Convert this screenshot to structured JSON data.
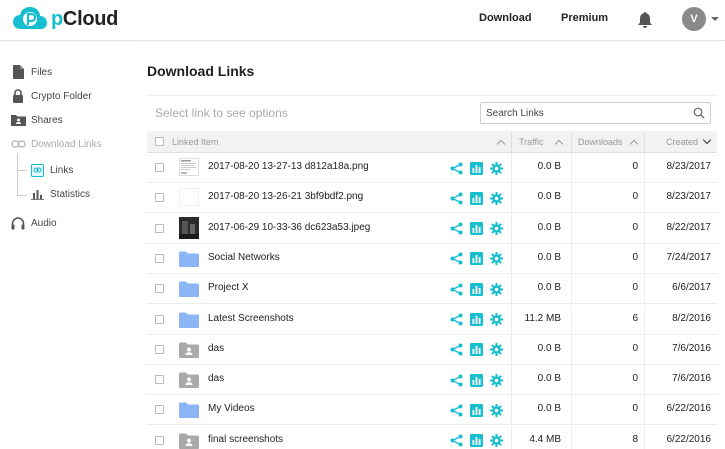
{
  "header": {
    "brand_prefix": "p",
    "brand_suffix": "Cloud",
    "nav_download": "Download",
    "nav_premium": "Premium",
    "avatar_initial": "V",
    "accent_color": "#17bed0"
  },
  "sidebar": {
    "items": [
      {
        "label": "Files",
        "icon": "file-icon"
      },
      {
        "label": "Crypto Folder",
        "icon": "lock-icon"
      },
      {
        "label": "Shares",
        "icon": "shared-folder-icon"
      },
      {
        "label": "Download Links",
        "icon": "link-icon",
        "state": "expanded"
      },
      {
        "label": "Links",
        "icon": "links-list-icon",
        "state": "selected"
      },
      {
        "label": "Statistics",
        "icon": "bar-chart-icon"
      },
      {
        "label": "Audio",
        "icon": "headphones-icon"
      }
    ]
  },
  "main": {
    "title": "Download Links",
    "select_hint": "Select link to see options",
    "search_placeholder": "Search Links",
    "columns": {
      "item": "Linked Item",
      "traffic": "Traffic",
      "downloads": "Downloads",
      "created": "Created"
    },
    "rows": [
      {
        "name": "2017-08-20 13-27-13 d812a18a.png",
        "type": "image-doc",
        "traffic": "0.0 B",
        "downloads": "0",
        "created": "8/23/2017"
      },
      {
        "name": "2017-08-20 13-26-21 3bf9bdf2.png",
        "type": "image-blank",
        "traffic": "0.0 B",
        "downloads": "0",
        "created": "8/23/2017"
      },
      {
        "name": "2017-06-29 10-33-36 dc623a53.jpeg",
        "type": "image-dark",
        "traffic": "0.0 B",
        "downloads": "0",
        "created": "8/22/2017"
      },
      {
        "name": "Social Networks",
        "type": "folder",
        "traffic": "0.0 B",
        "downloads": "0",
        "created": "7/24/2017"
      },
      {
        "name": "Project X",
        "type": "folder",
        "traffic": "0.0 B",
        "downloads": "0",
        "created": "6/6/2017"
      },
      {
        "name": "Latest Screenshots",
        "type": "folder",
        "traffic": "11.2 MB",
        "downloads": "6",
        "created": "8/2/2016"
      },
      {
        "name": "das",
        "type": "shared-folder",
        "traffic": "0.0 B",
        "downloads": "0",
        "created": "7/6/2016"
      },
      {
        "name": "das",
        "type": "shared-folder",
        "traffic": "0.0 B",
        "downloads": "0",
        "created": "7/6/2016"
      },
      {
        "name": "My Videos",
        "type": "folder",
        "traffic": "0.0 B",
        "downloads": "0",
        "created": "6/22/2016"
      },
      {
        "name": "final screenshots",
        "type": "shared-folder",
        "traffic": "4.4 MB",
        "downloads": "8",
        "created": "6/22/2016"
      }
    ]
  }
}
